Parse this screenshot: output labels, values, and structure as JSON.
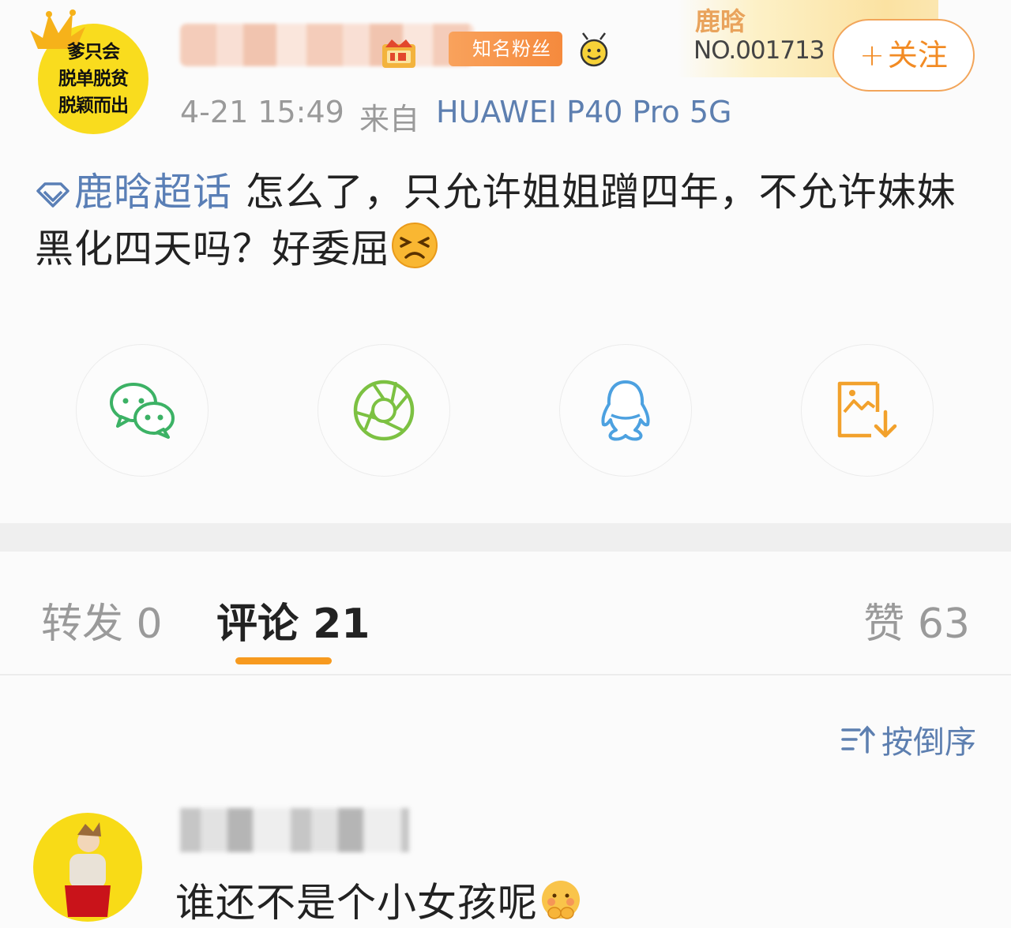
{
  "header": {
    "avatar_lines": [
      "爹只会",
      "脱单脱贫",
      "脱颖而出"
    ],
    "fan_badge_label": "知名粉丝",
    "fan_card": {
      "name": "鹿晗",
      "number": "NO.001713"
    },
    "follow_label": "关注",
    "time": "4-21 15:49",
    "source_prefix": "来自",
    "device": "HUAWEI P40 Pro 5G"
  },
  "post": {
    "topic": "鹿晗超话",
    "text": " 怎么了，只允许姐姐蹭四年，不允许妹妹黑化四天吗？好委屈"
  },
  "share": {
    "items": [
      "wechat-icon",
      "moments-icon",
      "qq-icon",
      "save-image-icon"
    ],
    "colors": {
      "wechat": "#3cb265",
      "moments": "#7cc142",
      "qq": "#4da1e0",
      "save": "#f2a12c"
    }
  },
  "tabs": {
    "repost": "转发 0",
    "comments": "评论 21",
    "likes": "赞 63",
    "accent": "#f79a1f"
  },
  "comments": {
    "sort_label": "按倒序",
    "items": [
      {
        "text": "谁还不是个小女孩呢"
      }
    ]
  }
}
